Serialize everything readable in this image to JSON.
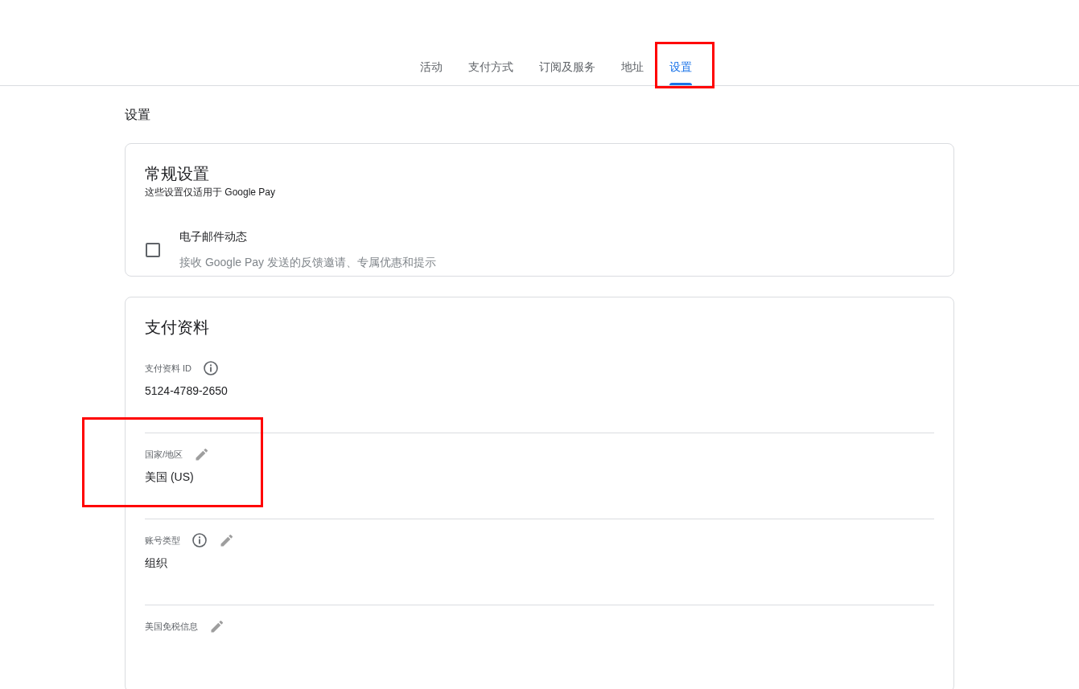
{
  "tabs": [
    {
      "label": "活动",
      "selected": false,
      "highlighted": false
    },
    {
      "label": "支付方式",
      "selected": false,
      "highlighted": false
    },
    {
      "label": "订阅及服务",
      "selected": false,
      "highlighted": false
    },
    {
      "label": "地址",
      "selected": false,
      "highlighted": false
    },
    {
      "label": "设置",
      "selected": true,
      "highlighted": true
    }
  ],
  "page_title": "设置",
  "general_settings": {
    "title": "常规设置",
    "subtitle": "这些设置仅适用于 Google Pay",
    "options": [
      {
        "label": "电子邮件动态",
        "description": "接收 Google Pay 发送的反馈邀请、专属优惠和提示",
        "checked": false
      }
    ]
  },
  "payments_profile": {
    "title": "支付资料",
    "fields": [
      {
        "label": "支付资料 ID",
        "value": "5124-4789-2650",
        "info": true,
        "editable": false,
        "highlighted": false
      },
      {
        "label": "国家/地区",
        "value": "美国 (US)",
        "info": false,
        "editable": true,
        "highlighted": true
      },
      {
        "label": "账号类型",
        "value": "组织",
        "info": true,
        "editable": true,
        "highlighted": false
      },
      {
        "label": "美国免税信息",
        "info": false,
        "editable": true,
        "highlighted": false
      }
    ]
  }
}
